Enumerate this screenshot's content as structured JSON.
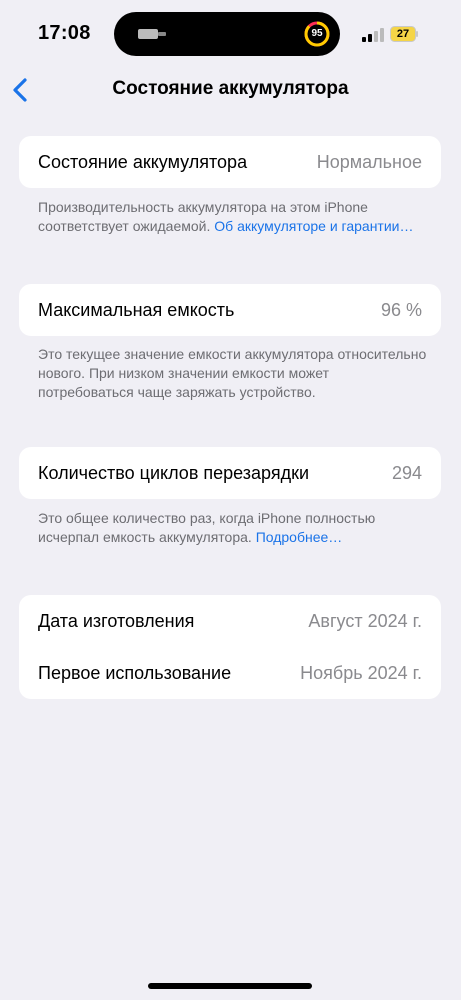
{
  "status_bar": {
    "time": "17:08",
    "activity_ring_value": "95",
    "battery_level": "27",
    "icons": [
      "app-activity-icon",
      "fitness-ring-icon",
      "cellular-signal-icon",
      "battery-icon"
    ]
  },
  "nav": {
    "back_icon": "chevron-left-icon",
    "title": "Состояние аккумулятора"
  },
  "battery_health": {
    "label": "Состояние аккумулятора",
    "value": "Нормальное",
    "note_text": "Производительность аккумулятора на этом iPhone соответствует ожидаемой. ",
    "note_link": "Об аккумуля­торе и гарантии…"
  },
  "max_capacity": {
    "label": "Максимальная емкость",
    "value": "96 %",
    "note_text": "Это текущее значение емкости аккумулятора относительно нового. При низком значении емкости может потребоваться чаще заряжать устройство."
  },
  "cycle_count": {
    "label": "Количество циклов перезарядки",
    "value": "294",
    "note_text": "Это общее количество раз, когда iPhone полностью исчерпал емкость аккумулятора. ",
    "note_link": "Подробнее…"
  },
  "dates": {
    "manufacture_label": "Дата изготовления",
    "manufacture_value": "Август 2024 г.",
    "first_use_label": "Первое использование",
    "first_use_value": "Ноябрь 2024 г."
  },
  "colors": {
    "background": "#f0eff5",
    "card": "#ffffff",
    "accent": "#1a73e8",
    "secondary_text": "#8a8a8e",
    "battery_fill": "#f5d547"
  }
}
